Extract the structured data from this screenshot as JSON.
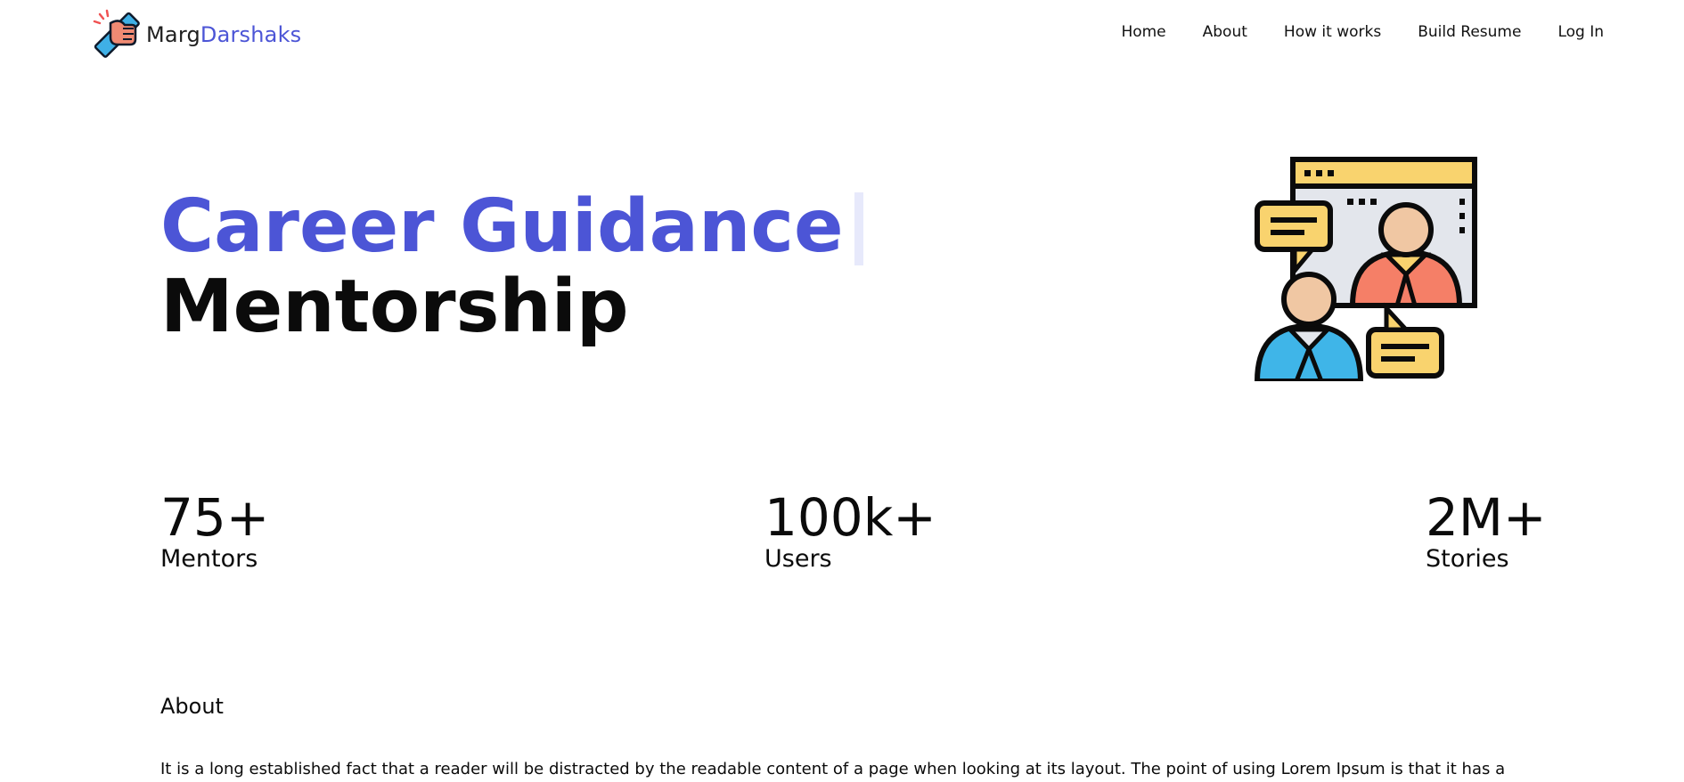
{
  "header": {
    "brand": {
      "name_part_1": "Marg",
      "name_part_2": "Darshaks",
      "logo_icon": "handshake-icon"
    },
    "nav": [
      {
        "label": "Home"
      },
      {
        "label": "About"
      },
      {
        "label": "How it works"
      },
      {
        "label": "Build Resume"
      },
      {
        "label": "Log In"
      }
    ]
  },
  "hero": {
    "title": "Career Guidance",
    "subtitle": "Mentorship",
    "illustration_icon": "video-mentoring-icon"
  },
  "stats": [
    {
      "value": "75+",
      "label": "Mentors"
    },
    {
      "value": "100k+",
      "label": "Users"
    },
    {
      "value": "2M+",
      "label": "Stories"
    }
  ],
  "about": {
    "heading": "About",
    "text": "It is a long established fact that a reader will be distracted by the readable content of a page when looking at its layout. The point of using Lorem Ipsum is that it has a"
  },
  "colors": {
    "accent": "#4c55d6",
    "text": "#0b0b0b",
    "caret": "#e7e9fb"
  }
}
